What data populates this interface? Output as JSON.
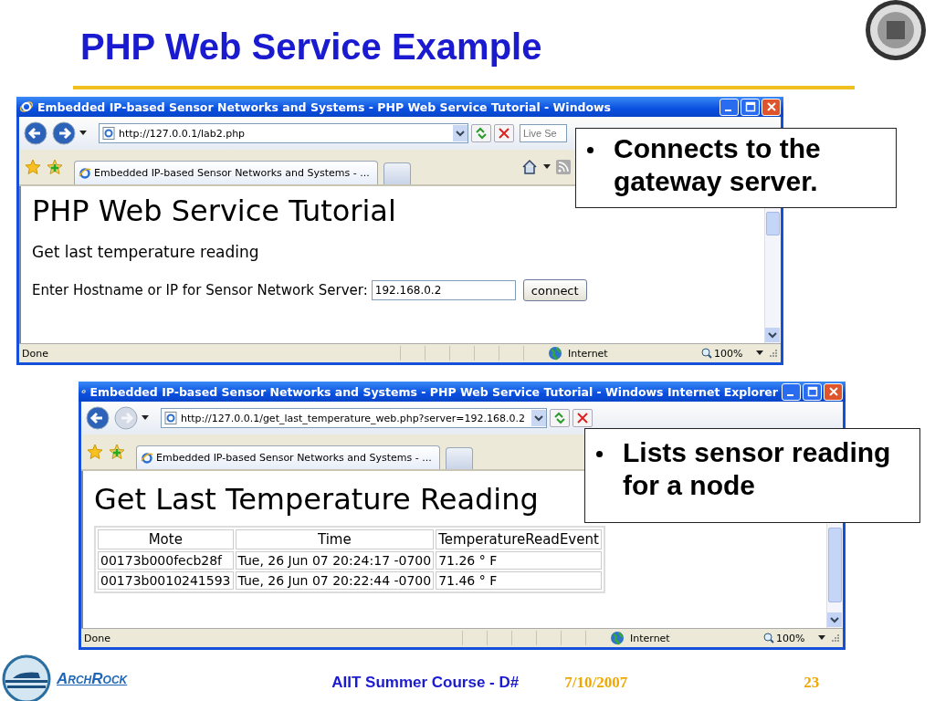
{
  "slide": {
    "title": "PHP Web Service Example"
  },
  "windows": [
    {
      "kind": "form",
      "title": "Embedded IP-based Sensor Networks and Systems - PHP Web Service Tutorial - Windows",
      "forward_enabled": true,
      "address": "http://127.0.0.1/lab2.php",
      "search_placeholder": "Live Se",
      "tab": "Embedded IP-based Sensor Networks and Systems - ...",
      "heading": "PHP Web Service Tutorial",
      "subheading": "Get last temperature reading",
      "field_label": "Enter Hostname or IP for Sensor Network Server:",
      "field_value": "192.168.0.2",
      "button": "connect",
      "status": "Done",
      "zone": "Internet",
      "zoom": "100%"
    },
    {
      "kind": "table",
      "title": "Embedded IP-based Sensor Networks and Systems - PHP Web Service Tutorial - Windows Internet Explorer",
      "forward_enabled": false,
      "address": "http://127.0.0.1/get_last_temperature_web.php?server=192.168.0.2",
      "tab": "Embedded IP-based Sensor Networks and Systems - ...",
      "heading": "Get Last Temperature Reading",
      "table": {
        "columns": [
          "Mote",
          "Time",
          "TemperatureReadEvent"
        ],
        "rows": [
          [
            "00173b000fecb28f",
            "Tue, 26 Jun 07 20:24:17 -0700",
            "71.26 ° F"
          ],
          [
            "00173b0010241593",
            "Tue, 26 Jun 07 20:22:44 -0700",
            "71.46 ° F"
          ]
        ]
      },
      "status": "Done",
      "zone": "Internet",
      "zoom": "100%"
    }
  ],
  "callouts": [
    {
      "text": "Connects to the gateway server."
    },
    {
      "text": "Lists sensor reading for a node"
    }
  ],
  "footer": {
    "logo": "ArchRock",
    "course": "AIIT Summer Course - D#",
    "date": "7/10/2007",
    "page": "23"
  }
}
